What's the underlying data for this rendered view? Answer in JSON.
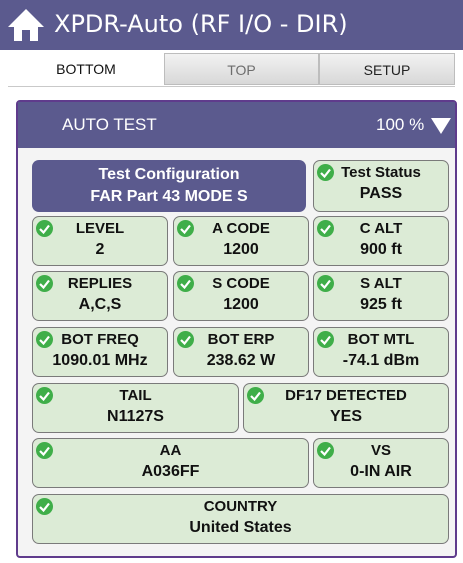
{
  "title": "XPDR-Auto (RF I/O - DIR)",
  "tabs": [
    {
      "label": "BOTTOM"
    },
    {
      "label": "TOP"
    },
    {
      "label": "SETUP"
    }
  ],
  "panel": {
    "title": "AUTO TEST",
    "percent": "100 %"
  },
  "config": {
    "label": "Test Configuration",
    "value": "FAR Part 43 MODE S"
  },
  "cells": {
    "status": {
      "label": "Test Status",
      "value": "PASS"
    },
    "level": {
      "label": "LEVEL",
      "value": "2"
    },
    "a_code": {
      "label": "A CODE",
      "value": "1200"
    },
    "c_alt": {
      "label": "C ALT",
      "value": "900 ft"
    },
    "replies": {
      "label": "REPLIES",
      "value": "A,C,S"
    },
    "s_code": {
      "label": "S CODE",
      "value": "1200"
    },
    "s_alt": {
      "label": "S ALT",
      "value": "925 ft"
    },
    "bot_freq": {
      "label": "BOT FREQ",
      "value": "1090.01 MHz"
    },
    "bot_erp": {
      "label": "BOT ERP",
      "value": "238.62 W"
    },
    "bot_mtl": {
      "label": "BOT MTL",
      "value": "-74.1 dBm"
    },
    "tail": {
      "label": "TAIL",
      "value": "N1127S"
    },
    "df17": {
      "label": "DF17 DETECTED",
      "value": "YES"
    },
    "aa": {
      "label": "AA",
      "value": "A036FF"
    },
    "vs": {
      "label": "VS",
      "value": "0-IN AIR"
    },
    "country": {
      "label": "COUNTRY",
      "value": "United States"
    }
  },
  "colors": {
    "header": "#5b5a8e",
    "pass_cell": "#dcebd6",
    "check": "#3fae49",
    "panel_border": "#5f3b8c"
  }
}
